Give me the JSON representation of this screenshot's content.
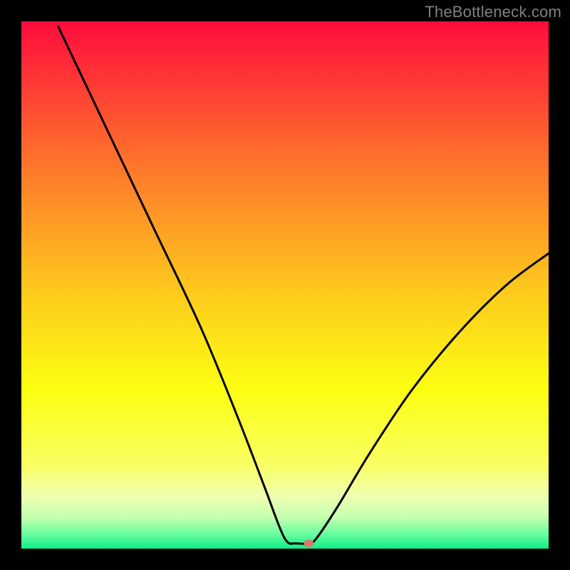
{
  "watermark": "TheBottleneck.com",
  "chart_data": {
    "type": "line",
    "title": "",
    "xlabel": "",
    "ylabel": "",
    "xlim": [
      0,
      100
    ],
    "ylim": [
      0,
      100
    ],
    "background": "rainbow-gradient-vertical",
    "gradient_stops": [
      {
        "offset": 0.0,
        "color": "#ff0c3c"
      },
      {
        "offset": 0.25,
        "color": "#fe6d2d"
      },
      {
        "offset": 0.5,
        "color": "#fdc61e"
      },
      {
        "offset": 0.7,
        "color": "#fcff12"
      },
      {
        "offset": 0.84,
        "color": "#f9ff62"
      },
      {
        "offset": 0.9,
        "color": "#f0ffb0"
      },
      {
        "offset": 0.94,
        "color": "#c6ffb0"
      },
      {
        "offset": 0.97,
        "color": "#6fffa0"
      },
      {
        "offset": 1.0,
        "color": "#11ed8a"
      }
    ],
    "series": [
      {
        "name": "bottleneck-curve",
        "color": "#000000",
        "type": "curve",
        "points": [
          {
            "x": 7.0,
            "y": 99.0
          },
          {
            "x": 16.0,
            "y": 80.0
          },
          {
            "x": 25.0,
            "y": 61.0
          },
          {
            "x": 34.0,
            "y": 42.0
          },
          {
            "x": 41.0,
            "y": 25.0
          },
          {
            "x": 46.0,
            "y": 12.0
          },
          {
            "x": 49.0,
            "y": 4.0
          },
          {
            "x": 50.5,
            "y": 1.2
          },
          {
            "x": 52.0,
            "y": 1.0
          },
          {
            "x": 54.5,
            "y": 1.0
          },
          {
            "x": 56.0,
            "y": 2.0
          },
          {
            "x": 60.0,
            "y": 8.0
          },
          {
            "x": 66.0,
            "y": 18.0
          },
          {
            "x": 74.0,
            "y": 30.0
          },
          {
            "x": 83.0,
            "y": 41.0
          },
          {
            "x": 92.0,
            "y": 50.0
          },
          {
            "x": 100.0,
            "y": 56.0
          }
        ]
      }
    ],
    "marker": {
      "x": 54.5,
      "y": 1.0,
      "color": "#d87a6c",
      "shape": "rounded-rect",
      "rx": 7,
      "ry": 5
    }
  }
}
